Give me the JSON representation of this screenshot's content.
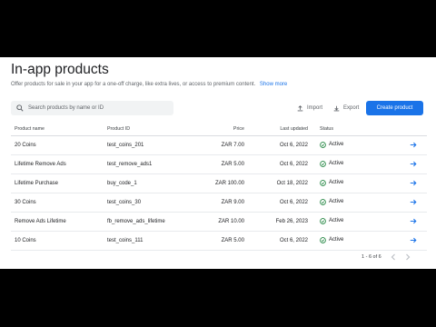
{
  "page": {
    "title": "In-app products",
    "description": "Offer products for sale in your app for a one-off charge, like extra lives, or access to premium content.",
    "show_more": "Show more"
  },
  "toolbar": {
    "search_placeholder": "Search products by name or ID",
    "import_label": "Import",
    "export_label": "Export",
    "create_label": "Create product"
  },
  "table": {
    "headers": {
      "name": "Product name",
      "id": "Product ID",
      "price": "Price",
      "updated": "Last updated",
      "status": "Status"
    },
    "rows": [
      {
        "name": "20 Coins",
        "id": "test_coins_201",
        "price": "ZAR 7.00",
        "updated": "Oct 6, 2022",
        "status": "Active"
      },
      {
        "name": "Lifetime Remove Ads",
        "id": "test_remove_ads1",
        "price": "ZAR 5.00",
        "updated": "Oct 6, 2022",
        "status": "Active"
      },
      {
        "name": "Lifetime Purchase",
        "id": "buy_code_1",
        "price": "ZAR 100.00",
        "updated": "Oct 18, 2022",
        "status": "Active"
      },
      {
        "name": "30 Coins",
        "id": "test_coins_30",
        "price": "ZAR 9.00",
        "updated": "Oct 6, 2022",
        "status": "Active"
      },
      {
        "name": "Remove Ads Lifetime",
        "id": "fb_remove_ads_lifetime",
        "price": "ZAR 10.00",
        "updated": "Feb 26, 2023",
        "status": "Active"
      },
      {
        "name": "10 Coins",
        "id": "test_coins_111",
        "price": "ZAR 5.00",
        "updated": "Oct 6, 2022",
        "status": "Active"
      }
    ]
  },
  "pagination": {
    "range": "1 - 6 of 6"
  },
  "colors": {
    "accent": "#1a73e8",
    "active": "#188038"
  }
}
